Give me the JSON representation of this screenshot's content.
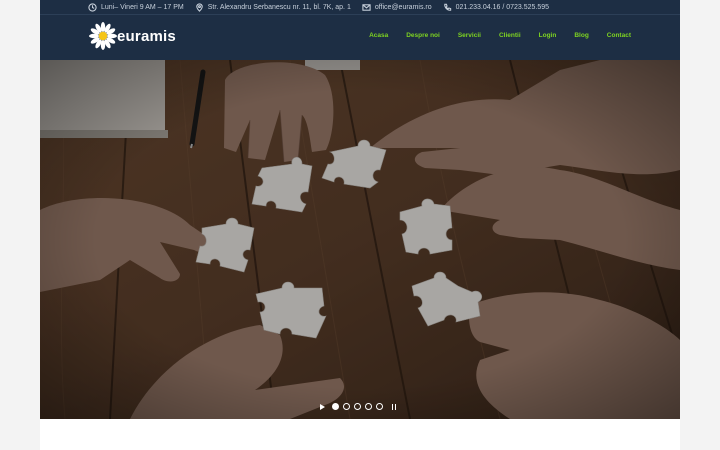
{
  "topbar": {
    "hours": "Luni– Vineri 9 AM – 17 PM",
    "address": "Str. Alexandru Serbanescu nr. 11, bl. 7K, ap. 1",
    "email": "office@euramis.ro",
    "phone": "021.233.04.16 / 0723.525.595"
  },
  "brand": {
    "name": "euramis"
  },
  "nav": {
    "items": [
      {
        "label": "Acasa"
      },
      {
        "label": "Despre noi"
      },
      {
        "label": "Servicii"
      },
      {
        "label": "Clientii"
      },
      {
        "label": "Login"
      },
      {
        "label": "Blog"
      },
      {
        "label": "Contact"
      }
    ]
  },
  "slider": {
    "slide_count": 5,
    "active_slide": 1
  },
  "colors": {
    "header_bg": "#1d2e44",
    "nav_accent": "#7ed321",
    "page_bg": "#f3f3f3"
  }
}
